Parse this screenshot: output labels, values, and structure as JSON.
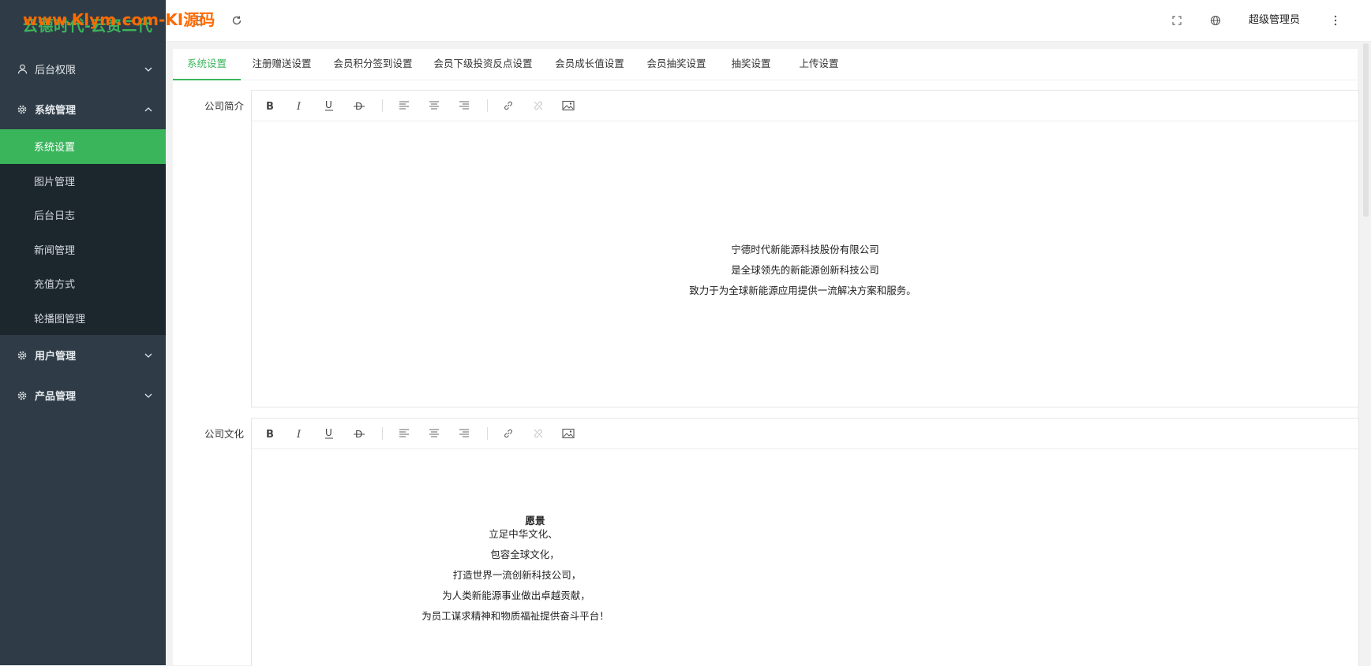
{
  "brand": {
    "title": "云德时代-云资二代",
    "watermark": "www.Klym.com-KI源码"
  },
  "sidebar": {
    "groups": [
      {
        "label": "后台权限",
        "icon": "user-icon"
      },
      {
        "label": "系统管理",
        "icon": "gear-icon",
        "expanded": true
      },
      {
        "label": "用户管理",
        "icon": "gear-icon"
      },
      {
        "label": "产品管理",
        "icon": "gear-icon"
      }
    ],
    "sub_items": [
      {
        "label": "系统设置",
        "active": true
      },
      {
        "label": "图片管理"
      },
      {
        "label": "后台日志"
      },
      {
        "label": "新闻管理"
      },
      {
        "label": "充值方式"
      },
      {
        "label": "轮播图管理"
      }
    ]
  },
  "header": {
    "icons": [
      "menu-fold-icon",
      "refresh-icon",
      "fullscreen-icon",
      "globe-icon",
      "more-vertical-icon"
    ],
    "user_name": "超级管理员"
  },
  "tabs": [
    "系统设置",
    "注册赠送设置",
    "会员积分签到设置",
    "会员下级投资反点设置",
    "会员成长值设置",
    "会员抽奖设置",
    "抽奖设置",
    "上传设置"
  ],
  "active_tab": "系统设置",
  "form": {
    "fields": [
      {
        "label": "公司简介",
        "content_lines": [
          "宁德时代新能源科技股份有限公司",
          "是全球领先的新能源创新科技公司",
          "致力于为全球新能源应用提供一流解决方案和服务。"
        ]
      },
      {
        "label": "公司文化",
        "content_heading": "愿景",
        "content_lines": [
          "立足中华文化、",
          "包容全球文化，",
          "打造世界一流创新科技公司，",
          "为人类新能源事业做出卓越贡献，",
          "为员工谋求精神和物质福祉提供奋斗平台！"
        ]
      }
    ],
    "toolbar_buttons": [
      "bold-icon",
      "italic-icon",
      "underline-icon",
      "strikethrough-icon",
      "align-left-icon",
      "align-center-icon",
      "align-right-icon",
      "link-icon",
      "unlink-icon",
      "image-icon"
    ]
  },
  "colors": {
    "accent": "#3bb55c",
    "sidebar_bg": "#2f3c47",
    "submenu_bg": "#1c262d",
    "watermark": "#ff6a00"
  }
}
